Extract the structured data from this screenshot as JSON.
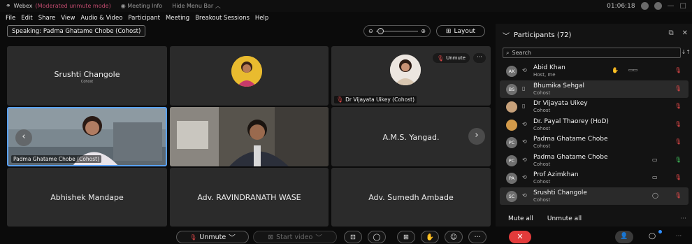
{
  "titlebar": {
    "logo": "⚭",
    "app": "Webex",
    "mode": "(Moderated unmute mode)",
    "meeting_info": "Meeting Info",
    "hide_menu": "Hide Menu Bar ︿",
    "time": "01:06:18",
    "minimize": "—",
    "maximize": "□"
  },
  "menu": [
    "File",
    "Edit",
    "Share",
    "View",
    "Audio & Video",
    "Participant",
    "Meeting",
    "Breakout Sessions",
    "Help"
  ],
  "speaking": "Speaking: Padma Ghatame Chobe (Cohost)",
  "zoom": {
    "minus": "⊖",
    "plus": "⊕"
  },
  "layout_label": "Layout",
  "tiles": [
    {
      "name": "Srushti Changole",
      "sub": "Cohost"
    },
    {
      "name": ""
    },
    {
      "name": "Dr Vijayata Uikey (Cohost)",
      "unmute": "Unmute",
      "more": "···"
    },
    {
      "name": "Padma Ghatame Chobe (Cohost)"
    },
    {
      "name": ""
    },
    {
      "name": "A.M.S. Yangad."
    },
    {
      "name": "Abhishek Mandape"
    },
    {
      "name": "Adv. RAVINDRANATH WASE"
    },
    {
      "name": "Adv. Sumedh Ambade"
    }
  ],
  "nav": {
    "prev": "‹",
    "next": "›"
  },
  "participants": {
    "title": "Participants (72)",
    "search_placeholder": "Search",
    "mute_all": "Mute all",
    "unmute_all": "Unmute all",
    "list": [
      {
        "initials": "AK",
        "name": "Abid Khan",
        "role": "Host, me",
        "av_color": "#6f6f6f"
      },
      {
        "initials": "BS",
        "name": "Bhumika Sehgal",
        "role": "Cohost",
        "av_color": "#6f6f6f"
      },
      {
        "initials": "",
        "name": "Dr Vijayata Uikey",
        "role": "Cohost",
        "av_color": "#c7a17a"
      },
      {
        "initials": "",
        "name": "Dr. Payal Thaorey (HoD)",
        "role": "Cohost",
        "av_color": "#d29a4a"
      },
      {
        "initials": "PC",
        "name": "Padma Ghatame Chobe",
        "role": "Cohost",
        "av_color": "#6f6f6f"
      },
      {
        "initials": "PC",
        "name": "Padma Ghatame Chobe",
        "role": "Cohost",
        "av_color": "#6f6f6f"
      },
      {
        "initials": "PA",
        "name": "Prof Azimkhan",
        "role": "Cohost",
        "av_color": "#6f6f6f"
      },
      {
        "initials": "SC",
        "name": "Srushti Changole",
        "role": "Cohost",
        "av_color": "#6f6f6f"
      }
    ]
  },
  "controls": {
    "unmute": "Unmute",
    "start_video": "Start video"
  },
  "colors": {
    "accent": "#5aa2ff",
    "danger": "#e23b3b",
    "tile": "#2b2b2b"
  }
}
